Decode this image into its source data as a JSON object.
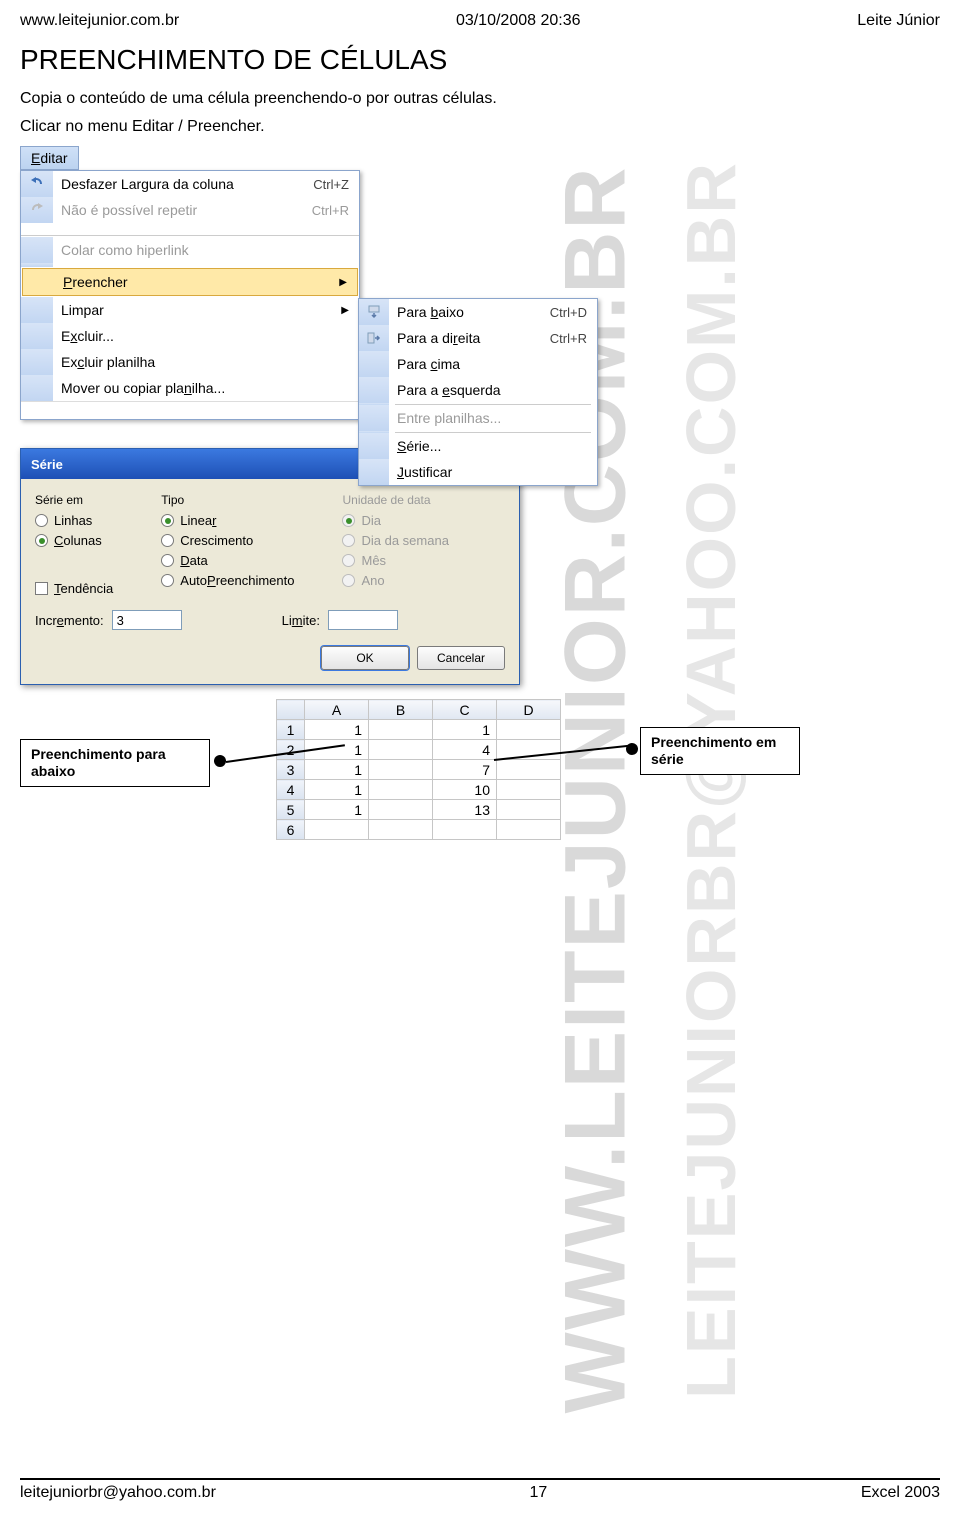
{
  "header": {
    "left": "www.leitejunior.com.br",
    "center": "03/10/2008 20:36",
    "right": "Leite Júnior"
  },
  "title": "PREENCHIMENTO DE CÉLULAS",
  "intro1": "Copia o conteúdo de uma célula preenchendo-o por outras células.",
  "intro2": "Clicar no menu Editar / Preencher.",
  "menu": {
    "editar": "Editar",
    "items": {
      "undo": "Desfazer Largura da coluna",
      "undo_sc": "Ctrl+Z",
      "redo": "Não é possível repetir",
      "redo_sc": "Ctrl+R",
      "colar_hyperlink": "Colar como hiperlink",
      "preencher": "Preencher",
      "limpar": "Limpar",
      "excluir": "Excluir...",
      "excluir_plan": "Excluir planilha",
      "mover": "Mover ou copiar planilha..."
    },
    "sub": {
      "baixo": "Para baixo",
      "baixo_sc": "Ctrl+D",
      "direita": "Para a direita",
      "direita_sc": "Ctrl+R",
      "cima": "Para cima",
      "esquerda": "Para a esquerda",
      "planilhas": "Entre planilhas...",
      "serie": "Série...",
      "justificar": "Justificar"
    }
  },
  "dialog": {
    "title": "Série",
    "groups": {
      "serie_em": "Série em",
      "tipo": "Tipo",
      "unidade": "Unidade de data"
    },
    "serie_em": {
      "linhas": "Linhas",
      "colunas": "Colunas"
    },
    "tipo": {
      "linear": "Linear",
      "crescimento": "Crescimento",
      "data": "Data",
      "auto": "AutoPreenchimento"
    },
    "unidade": {
      "dia": "Dia",
      "dia_semana": "Dia da semana",
      "mes": "Mês",
      "ano": "Ano"
    },
    "tendencia": "Tendência",
    "incremento_lbl": "Incremento:",
    "incremento_val": "3",
    "limite_lbl": "Limite:",
    "limite_val": "",
    "ok": "OK",
    "cancelar": "Cancelar"
  },
  "chart_data": {
    "type": "table",
    "columns": [
      "A",
      "B",
      "C",
      "D"
    ],
    "rows": [
      {
        "n": "1",
        "A": "1",
        "B": "",
        "C": "1",
        "D": ""
      },
      {
        "n": "2",
        "A": "1",
        "B": "",
        "C": "4",
        "D": ""
      },
      {
        "n": "3",
        "A": "1",
        "B": "",
        "C": "7",
        "D": ""
      },
      {
        "n": "4",
        "A": "1",
        "B": "",
        "C": "10",
        "D": ""
      },
      {
        "n": "5",
        "A": "1",
        "B": "",
        "C": "13",
        "D": ""
      },
      {
        "n": "6",
        "A": "",
        "B": "",
        "C": "",
        "D": ""
      }
    ]
  },
  "callouts": {
    "abaixo": "Preenchimento para abaixo",
    "serie": "Preenchimento em série"
  },
  "watermarks": {
    "w1": "WWW.LEITEJUNIOR.COM.BR",
    "w2": "LEITEJUNIORBR@YAHOO.COM.BR"
  },
  "footer": {
    "left": "leitejuniorbr@yahoo.com.br",
    "center": "17",
    "right": "Excel 2003"
  }
}
